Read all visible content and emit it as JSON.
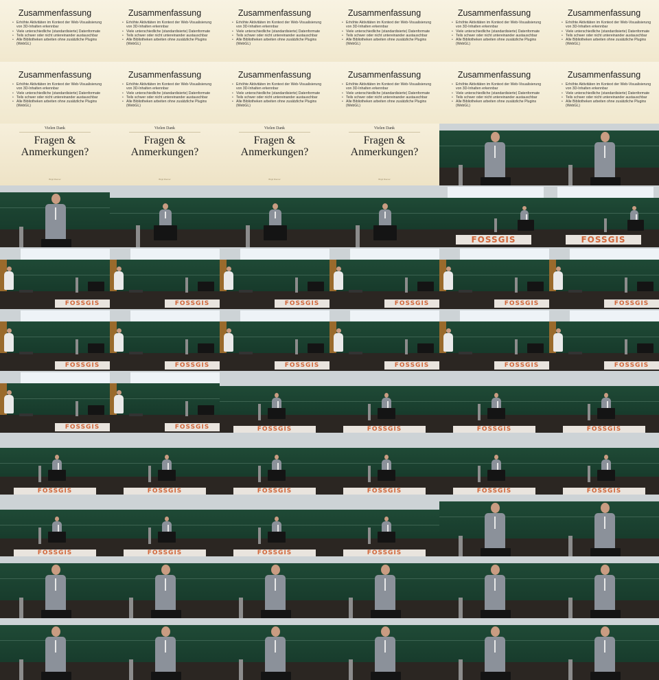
{
  "summary_slide": {
    "title": "Zusammenfassung",
    "bullets": [
      "Erhöhte Aktivitäten im Kontext der Web-Visualisierung von 3D-Inhalten erkennbar",
      "Viele unterschiedliche (standardisierte) Datenformate",
      "Teils schwer oder nicht untereinander austauschbar",
      "Alle Bibliotheken arbeiten ohne zusätzliche Plugins (WebGL)"
    ]
  },
  "questions_slide": {
    "header": "Vielen Dank",
    "title_line1": "Fragen &",
    "title_line2": "Anmerkungen?",
    "footer": "Birgit Riemer"
  },
  "banner_text": "FOSSGIS",
  "tiles": [
    "summary",
    "summary",
    "summary",
    "summary",
    "summary",
    "summary",
    "summary",
    "summary",
    "summary",
    "summary",
    "summary",
    "summary",
    "questions",
    "questions",
    "questions",
    "questions",
    "close",
    "close",
    "close",
    "mid",
    "mid",
    "mid",
    "wide",
    "wide",
    "side",
    "side",
    "side",
    "side",
    "side",
    "side",
    "side",
    "side",
    "side",
    "side",
    "side",
    "side",
    "side",
    "side",
    "far",
    "far",
    "far",
    "far",
    "far",
    "far",
    "far",
    "far",
    "far",
    "far",
    "far",
    "far",
    "far",
    "far",
    "close",
    "close",
    "close",
    "close",
    "close",
    "close",
    "close",
    "close",
    "close",
    "close",
    "close",
    "close",
    "close",
    "close"
  ],
  "colors": {
    "slide_background": "#f4ecd6",
    "chalkboard": "#1f4a36",
    "banner_orange": "#d2683b"
  }
}
